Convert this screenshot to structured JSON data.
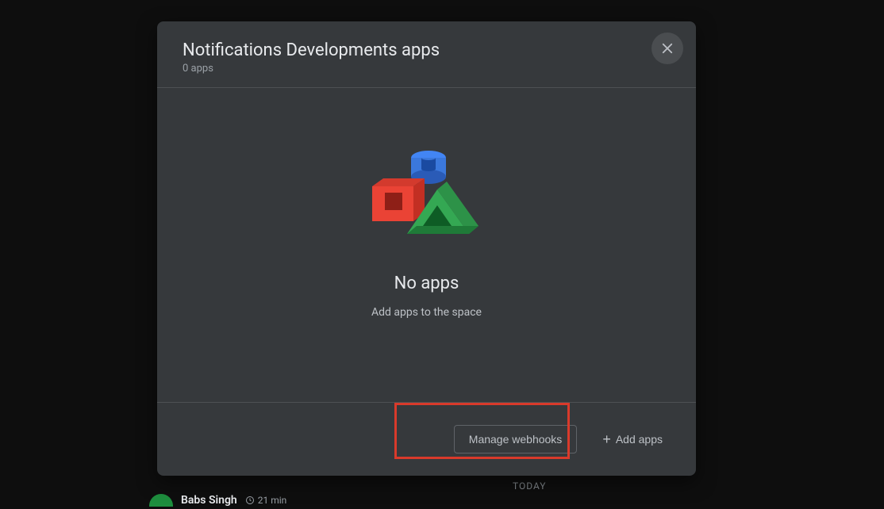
{
  "dialog": {
    "title": "Notifications Developments apps",
    "subtitle": "0 apps",
    "empty_title": "No apps",
    "empty_subtitle": "Add apps to the space",
    "manage_webhooks_label": "Manage webhooks",
    "add_apps_label": "Add apps"
  },
  "background": {
    "today_label": "TODAY",
    "user_name": "Babs Singh",
    "time_label": "21 min"
  }
}
